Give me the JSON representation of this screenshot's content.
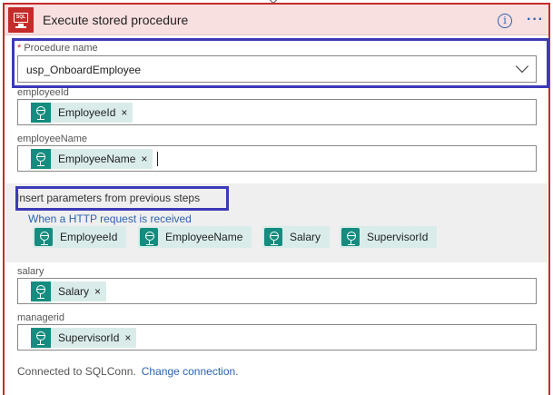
{
  "header": {
    "icon": "sql-connector-icon",
    "icon_text": "SQL",
    "title": "Execute stored procedure",
    "info_glyph": "i",
    "more_glyph": "···"
  },
  "procedure": {
    "required_mark": "*",
    "label": " Procedure name",
    "value": "usp_OnboardEmployee"
  },
  "fields": {
    "employeeid": {
      "label": "employeeId",
      "token": "EmployeeId",
      "remove": "×"
    },
    "employeename": {
      "label": "employeeName",
      "token": "EmployeeName",
      "remove": "×"
    },
    "salary": {
      "label": "salary",
      "token": "Salary",
      "remove": "×"
    },
    "managerid": {
      "label": "managerid",
      "token": "SupervisorId",
      "remove": "×"
    }
  },
  "params_panel": {
    "heading": "Insert parameters from previous steps",
    "source": "When a HTTP request is received",
    "tokens": [
      "EmployeeId",
      "EmployeeName",
      "Salary",
      "SupervisorId"
    ]
  },
  "footer": {
    "connected_text": "Connected to SQLConn.",
    "change_link": "Change connection."
  },
  "colors": {
    "accent_red": "#c42b2b",
    "header_bg": "#f8dfe0",
    "token_icon": "#158c7f",
    "token_bg": "#d9ecea",
    "link_blue": "#2c62b0",
    "highlight_box": "#3c3ab6"
  }
}
